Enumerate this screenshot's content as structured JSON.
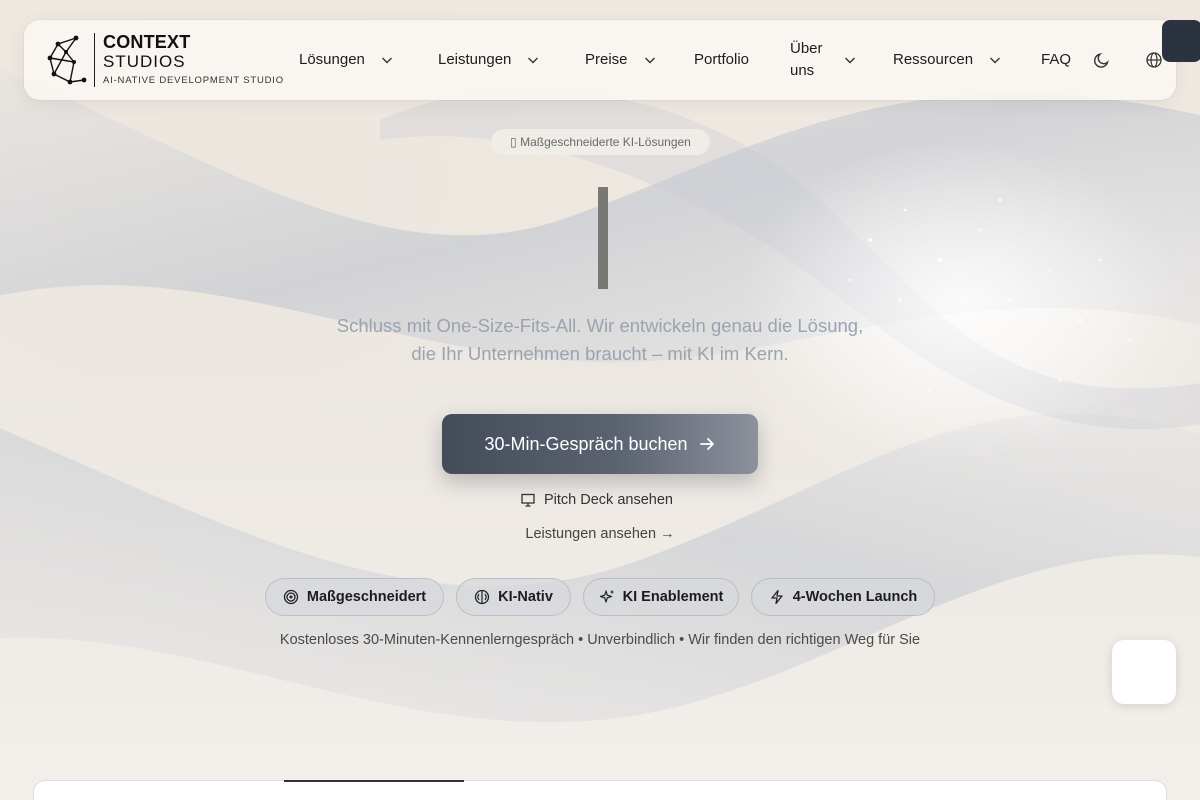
{
  "brand": {
    "line1": "CONTEXT",
    "line2": "STUDIOS",
    "tagline": "AI-NATIVE DEVELOPMENT STUDIO"
  },
  "nav": {
    "items": [
      {
        "label": "Lösungen",
        "has_dropdown": true
      },
      {
        "label": "Leistungen",
        "has_dropdown": true
      },
      {
        "label": "Preise",
        "has_dropdown": true
      },
      {
        "label": "Portfolio",
        "has_dropdown": false
      },
      {
        "label": "Über uns",
        "has_dropdown": true
      },
      {
        "label": "Ressourcen",
        "has_dropdown": true
      },
      {
        "label": "FAQ",
        "has_dropdown": false
      }
    ],
    "icons": [
      "moon-icon",
      "globe-icon"
    ]
  },
  "hero": {
    "badge": "▯ Maßgeschneiderte KI-Lösungen",
    "subtitle": "Schluss mit One-Size-Fits-All. Wir entwickeln genau die Lösung, die Ihr Unternehmen braucht – mit KI im Kern.",
    "cta_label": "30-Min-Gespräch buchen",
    "pitch_label": "Pitch Deck ansehen",
    "services_link": "Leistungen ansehen →",
    "chips": [
      {
        "label": "Maßgeschneidert",
        "icon": "target-icon"
      },
      {
        "label": "KI-Nativ",
        "icon": "brain-icon"
      },
      {
        "label": "KI Enablement",
        "icon": "sparkles-icon"
      },
      {
        "label": "4-Wochen Launch",
        "icon": "zap-icon"
      }
    ],
    "footnote": "Kostenloses 30-Minuten-Kennenlerngespräch • Unverbindlich • Wir finden den richtigen Weg für Sie"
  },
  "colors": {
    "cta_start": "#454c59",
    "cta_end": "#8c929c",
    "subtitle": "#9aa3b0"
  }
}
